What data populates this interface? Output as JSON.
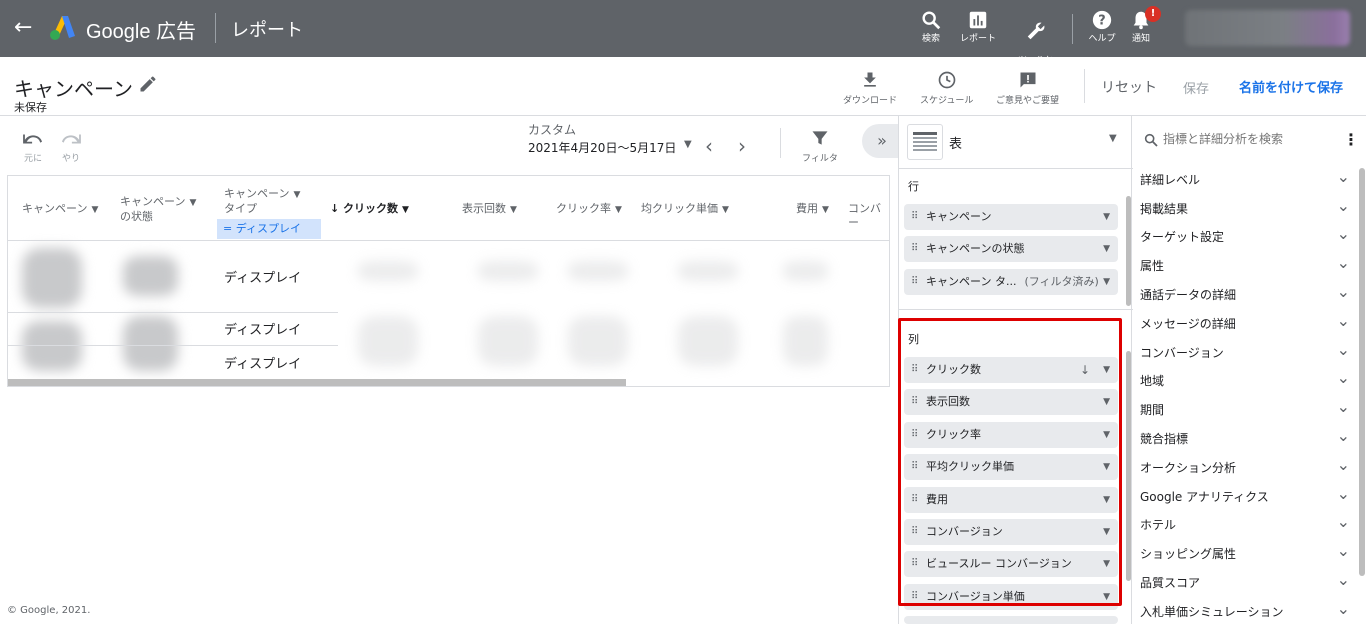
{
  "topbar": {
    "brand": "Google 広告",
    "section": "レポート",
    "search_label": "検索",
    "reports_label": "レポート",
    "tools_label": "ツールと\n設定",
    "help_label": "ヘルプ",
    "notifications_label": "通知",
    "notification_badge": "!"
  },
  "subheader": {
    "title": "キャンペーン",
    "status": "未保存",
    "download_label": "ダウンロード",
    "schedule_label": "スケジュール",
    "feedback_label": "ご意見やご要望",
    "reset_label": "リセット",
    "save_label": "保存",
    "save_as_label": "名前を付けて保存"
  },
  "toolbar": {
    "undo_label": "元に",
    "redo_label": "やり",
    "date_label": "カスタム",
    "date_range": "2021年4月20日～5月17日",
    "filter_label": "フィルタ",
    "collapse_symbol": "»"
  },
  "table": {
    "headers": {
      "campaign": "キャンペーン",
      "status_l1": "キャンペーン",
      "status_l2": "の状態",
      "type_l1": "キャンペーン",
      "type_l2": "タイプ",
      "clicks": "クリック数",
      "impressions": "表示回数",
      "ctr": "クリック率",
      "avg_cpc": "均クリック単価",
      "cost": "費用",
      "conversions": "コンバー"
    },
    "type_filter": "= ディスプレイ",
    "rows": [
      {
        "type": "ディスプレイ"
      },
      {
        "type": "ディスプレイ"
      },
      {
        "type": "ディスプレイ"
      }
    ]
  },
  "footer": "© Google, 2021.",
  "editor": {
    "visualization": "表",
    "rows_label": "行",
    "row_fields": [
      {
        "label": "キャンペーン"
      },
      {
        "label": "キャンペーンの状態"
      },
      {
        "label": "キャンペーン タ...",
        "tag": "(フィルタ済み)"
      }
    ],
    "columns_label": "列",
    "column_fields": [
      {
        "label": "クリック数",
        "sort": "↓"
      },
      {
        "label": "表示回数"
      },
      {
        "label": "クリック率"
      },
      {
        "label": "平均クリック単価"
      },
      {
        "label": "費用"
      },
      {
        "label": "コンバージョン"
      },
      {
        "label": "ビュースルー コンバージョン"
      },
      {
        "label": "コンバージョン単価"
      }
    ],
    "highlight_color": "#dd0000"
  },
  "metrics_panel": {
    "search_placeholder": "指標と詳細分析を検索",
    "categories": [
      "詳細レベル",
      "掲載結果",
      "ターゲット設定",
      "属性",
      "通話データの詳細",
      "メッセージの詳細",
      "コンバージョン",
      "地域",
      "期間",
      "競合指標",
      "オークション分析",
      "Google アナリティクス",
      "ホテル",
      "ショッピング属性",
      "品質スコア",
      "入札単価シミュレーション"
    ]
  }
}
